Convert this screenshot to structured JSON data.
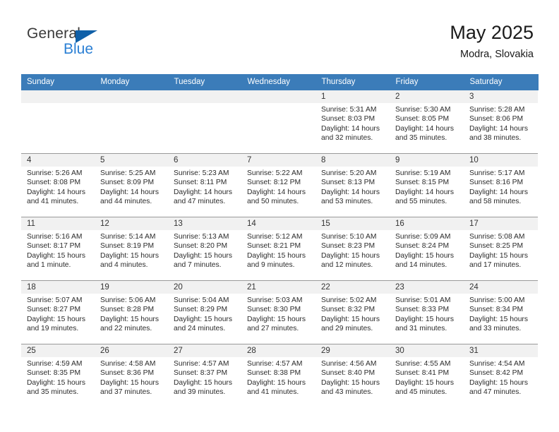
{
  "brand": {
    "name_part1": "General",
    "name_part2": "Blue",
    "triangle_color": "#1060a8",
    "blue_color": "#2a7fd4"
  },
  "header": {
    "title": "May 2025",
    "subtitle": "Modra, Slovakia",
    "accent_color": "#3b7cb9",
    "daynum_band_color": "#f1f1f1"
  },
  "weekday_headers": [
    "Sunday",
    "Monday",
    "Tuesday",
    "Wednesday",
    "Thursday",
    "Friday",
    "Saturday"
  ],
  "weeks": [
    [
      {
        "day": "",
        "sunrise": "",
        "sunset": "",
        "daylight1": "",
        "daylight2": ""
      },
      {
        "day": "",
        "sunrise": "",
        "sunset": "",
        "daylight1": "",
        "daylight2": ""
      },
      {
        "day": "",
        "sunrise": "",
        "sunset": "",
        "daylight1": "",
        "daylight2": ""
      },
      {
        "day": "",
        "sunrise": "",
        "sunset": "",
        "daylight1": "",
        "daylight2": ""
      },
      {
        "day": "1",
        "sunrise": "Sunrise: 5:31 AM",
        "sunset": "Sunset: 8:03 PM",
        "daylight1": "Daylight: 14 hours",
        "daylight2": "and 32 minutes."
      },
      {
        "day": "2",
        "sunrise": "Sunrise: 5:30 AM",
        "sunset": "Sunset: 8:05 PM",
        "daylight1": "Daylight: 14 hours",
        "daylight2": "and 35 minutes."
      },
      {
        "day": "3",
        "sunrise": "Sunrise: 5:28 AM",
        "sunset": "Sunset: 8:06 PM",
        "daylight1": "Daylight: 14 hours",
        "daylight2": "and 38 minutes."
      }
    ],
    [
      {
        "day": "4",
        "sunrise": "Sunrise: 5:26 AM",
        "sunset": "Sunset: 8:08 PM",
        "daylight1": "Daylight: 14 hours",
        "daylight2": "and 41 minutes."
      },
      {
        "day": "5",
        "sunrise": "Sunrise: 5:25 AM",
        "sunset": "Sunset: 8:09 PM",
        "daylight1": "Daylight: 14 hours",
        "daylight2": "and 44 minutes."
      },
      {
        "day": "6",
        "sunrise": "Sunrise: 5:23 AM",
        "sunset": "Sunset: 8:11 PM",
        "daylight1": "Daylight: 14 hours",
        "daylight2": "and 47 minutes."
      },
      {
        "day": "7",
        "sunrise": "Sunrise: 5:22 AM",
        "sunset": "Sunset: 8:12 PM",
        "daylight1": "Daylight: 14 hours",
        "daylight2": "and 50 minutes."
      },
      {
        "day": "8",
        "sunrise": "Sunrise: 5:20 AM",
        "sunset": "Sunset: 8:13 PM",
        "daylight1": "Daylight: 14 hours",
        "daylight2": "and 53 minutes."
      },
      {
        "day": "9",
        "sunrise": "Sunrise: 5:19 AM",
        "sunset": "Sunset: 8:15 PM",
        "daylight1": "Daylight: 14 hours",
        "daylight2": "and 55 minutes."
      },
      {
        "day": "10",
        "sunrise": "Sunrise: 5:17 AM",
        "sunset": "Sunset: 8:16 PM",
        "daylight1": "Daylight: 14 hours",
        "daylight2": "and 58 minutes."
      }
    ],
    [
      {
        "day": "11",
        "sunrise": "Sunrise: 5:16 AM",
        "sunset": "Sunset: 8:17 PM",
        "daylight1": "Daylight: 15 hours",
        "daylight2": "and 1 minute."
      },
      {
        "day": "12",
        "sunrise": "Sunrise: 5:14 AM",
        "sunset": "Sunset: 8:19 PM",
        "daylight1": "Daylight: 15 hours",
        "daylight2": "and 4 minutes."
      },
      {
        "day": "13",
        "sunrise": "Sunrise: 5:13 AM",
        "sunset": "Sunset: 8:20 PM",
        "daylight1": "Daylight: 15 hours",
        "daylight2": "and 7 minutes."
      },
      {
        "day": "14",
        "sunrise": "Sunrise: 5:12 AM",
        "sunset": "Sunset: 8:21 PM",
        "daylight1": "Daylight: 15 hours",
        "daylight2": "and 9 minutes."
      },
      {
        "day": "15",
        "sunrise": "Sunrise: 5:10 AM",
        "sunset": "Sunset: 8:23 PM",
        "daylight1": "Daylight: 15 hours",
        "daylight2": "and 12 minutes."
      },
      {
        "day": "16",
        "sunrise": "Sunrise: 5:09 AM",
        "sunset": "Sunset: 8:24 PM",
        "daylight1": "Daylight: 15 hours",
        "daylight2": "and 14 minutes."
      },
      {
        "day": "17",
        "sunrise": "Sunrise: 5:08 AM",
        "sunset": "Sunset: 8:25 PM",
        "daylight1": "Daylight: 15 hours",
        "daylight2": "and 17 minutes."
      }
    ],
    [
      {
        "day": "18",
        "sunrise": "Sunrise: 5:07 AM",
        "sunset": "Sunset: 8:27 PM",
        "daylight1": "Daylight: 15 hours",
        "daylight2": "and 19 minutes."
      },
      {
        "day": "19",
        "sunrise": "Sunrise: 5:06 AM",
        "sunset": "Sunset: 8:28 PM",
        "daylight1": "Daylight: 15 hours",
        "daylight2": "and 22 minutes."
      },
      {
        "day": "20",
        "sunrise": "Sunrise: 5:04 AM",
        "sunset": "Sunset: 8:29 PM",
        "daylight1": "Daylight: 15 hours",
        "daylight2": "and 24 minutes."
      },
      {
        "day": "21",
        "sunrise": "Sunrise: 5:03 AM",
        "sunset": "Sunset: 8:30 PM",
        "daylight1": "Daylight: 15 hours",
        "daylight2": "and 27 minutes."
      },
      {
        "day": "22",
        "sunrise": "Sunrise: 5:02 AM",
        "sunset": "Sunset: 8:32 PM",
        "daylight1": "Daylight: 15 hours",
        "daylight2": "and 29 minutes."
      },
      {
        "day": "23",
        "sunrise": "Sunrise: 5:01 AM",
        "sunset": "Sunset: 8:33 PM",
        "daylight1": "Daylight: 15 hours",
        "daylight2": "and 31 minutes."
      },
      {
        "day": "24",
        "sunrise": "Sunrise: 5:00 AM",
        "sunset": "Sunset: 8:34 PM",
        "daylight1": "Daylight: 15 hours",
        "daylight2": "and 33 minutes."
      }
    ],
    [
      {
        "day": "25",
        "sunrise": "Sunrise: 4:59 AM",
        "sunset": "Sunset: 8:35 PM",
        "daylight1": "Daylight: 15 hours",
        "daylight2": "and 35 minutes."
      },
      {
        "day": "26",
        "sunrise": "Sunrise: 4:58 AM",
        "sunset": "Sunset: 8:36 PM",
        "daylight1": "Daylight: 15 hours",
        "daylight2": "and 37 minutes."
      },
      {
        "day": "27",
        "sunrise": "Sunrise: 4:57 AM",
        "sunset": "Sunset: 8:37 PM",
        "daylight1": "Daylight: 15 hours",
        "daylight2": "and 39 minutes."
      },
      {
        "day": "28",
        "sunrise": "Sunrise: 4:57 AM",
        "sunset": "Sunset: 8:38 PM",
        "daylight1": "Daylight: 15 hours",
        "daylight2": "and 41 minutes."
      },
      {
        "day": "29",
        "sunrise": "Sunrise: 4:56 AM",
        "sunset": "Sunset: 8:40 PM",
        "daylight1": "Daylight: 15 hours",
        "daylight2": "and 43 minutes."
      },
      {
        "day": "30",
        "sunrise": "Sunrise: 4:55 AM",
        "sunset": "Sunset: 8:41 PM",
        "daylight1": "Daylight: 15 hours",
        "daylight2": "and 45 minutes."
      },
      {
        "day": "31",
        "sunrise": "Sunrise: 4:54 AM",
        "sunset": "Sunset: 8:42 PM",
        "daylight1": "Daylight: 15 hours",
        "daylight2": "and 47 minutes."
      }
    ]
  ]
}
